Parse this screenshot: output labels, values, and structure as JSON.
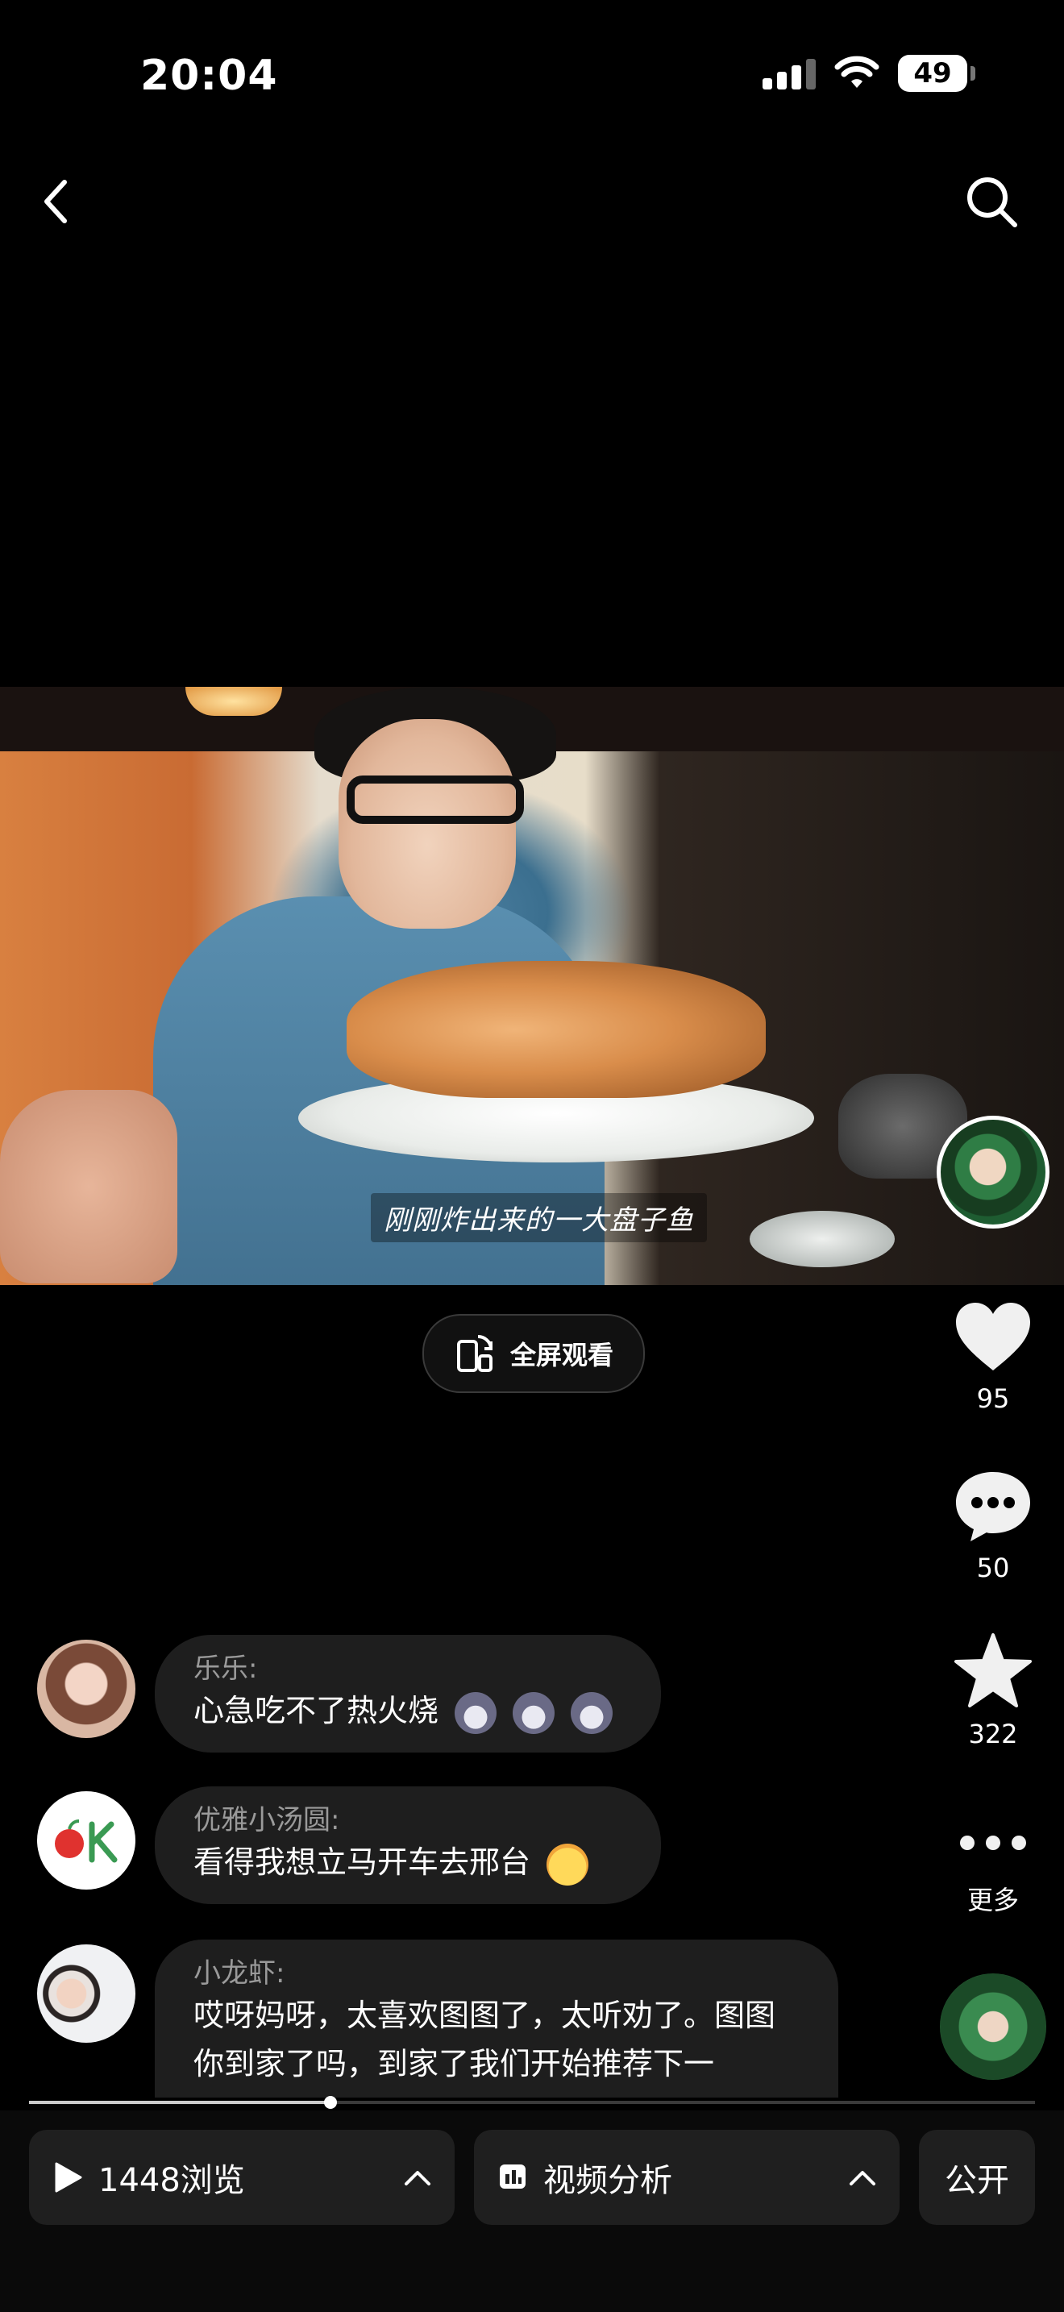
{
  "status_bar": {
    "time": "20:04",
    "battery": "49"
  },
  "video": {
    "caption": "刚刚炸出来的一大盘子鱼"
  },
  "fullscreen": {
    "label": "全屏观看"
  },
  "actions": {
    "likes": "95",
    "comments": "50",
    "favorites": "322",
    "more_label": "更多"
  },
  "comments": [
    {
      "name": "乐乐:",
      "text": "心急吃不了热火烧"
    },
    {
      "name": "优雅小汤圆:",
      "text": "看得我想立马开车去邢台"
    },
    {
      "name": "小龙虾:",
      "text": "哎呀妈呀，太喜欢图图了，太听劝了。图图你到家了吗，到家了我们开始推荐下一"
    }
  ],
  "playback": {
    "progress": 0.3
  },
  "bottom_bar": {
    "views_label": "1448浏览",
    "analysis_label": "视频分析",
    "public_label": "公开"
  }
}
